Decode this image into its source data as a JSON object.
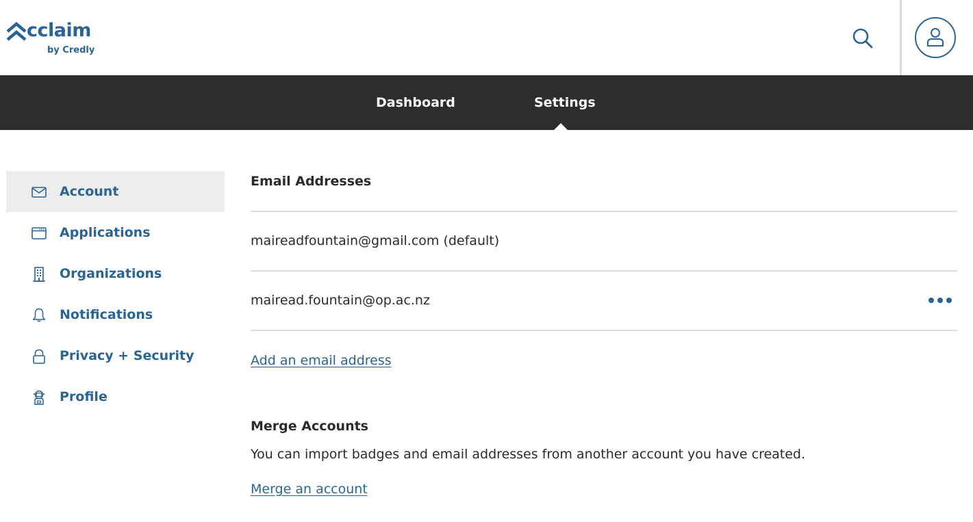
{
  "header": {
    "logo": {
      "word": "cclaim",
      "mark_icon": "acclaim-chevron-icon",
      "sub": "by Credly",
      "brand_color": "#2a6496"
    },
    "search_icon": "search-icon",
    "avatar_icon": "user-icon"
  },
  "nav": {
    "tabs": [
      {
        "label": "Dashboard",
        "active": false
      },
      {
        "label": "Settings",
        "active": true
      }
    ],
    "background_color": "#2d2d2d"
  },
  "sidebar": {
    "items": [
      {
        "label": "Account",
        "icon": "envelope-icon",
        "active": true
      },
      {
        "label": "Applications",
        "icon": "browser-window-icon",
        "active": false
      },
      {
        "label": "Organizations",
        "icon": "building-icon",
        "active": false
      },
      {
        "label": "Notifications",
        "icon": "bell-icon",
        "active": false
      },
      {
        "label": "Privacy + Security",
        "icon": "lock-icon",
        "active": false
      },
      {
        "label": "Profile",
        "icon": "astronaut-icon",
        "active": false
      }
    ],
    "active_background": "#ededed"
  },
  "main": {
    "email_section": {
      "title": "Email Addresses",
      "emails": [
        {
          "address": "maireadfountain@gmail.com (default)",
          "has_menu": false
        },
        {
          "address": "mairead.fountain@op.ac.nz",
          "has_menu": true,
          "menu_icon": "more-horizontal-icon"
        }
      ],
      "add_link": "Add an email address"
    },
    "merge_section": {
      "title": "Merge Accounts",
      "description": "You can import badges and email addresses from another account you have created.",
      "link": "Merge an account"
    }
  },
  "colors": {
    "link": "#2a6496",
    "text": "#2b2b2b",
    "divider": "#dddddd"
  }
}
